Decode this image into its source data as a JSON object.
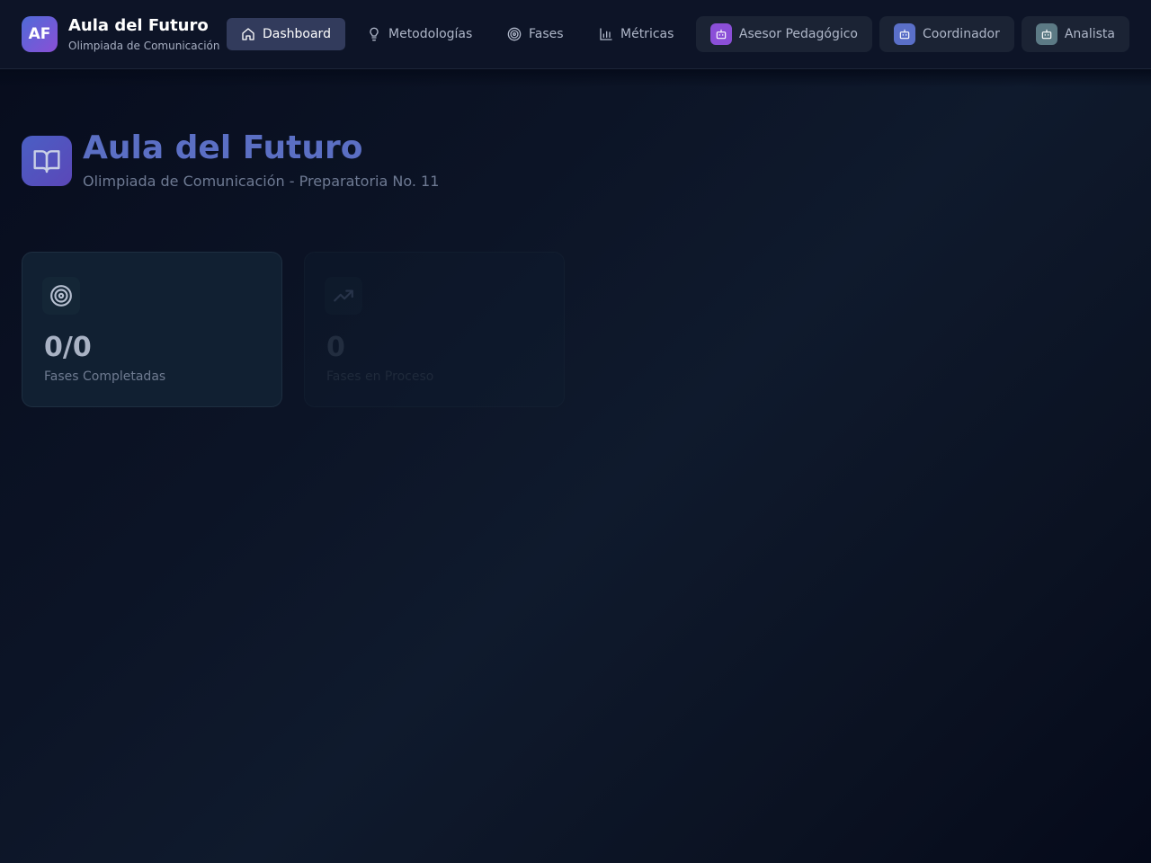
{
  "brand": {
    "logo_text": "AF",
    "title": "Aula del Futuro",
    "subtitle": "Olimpiada de Comunicación"
  },
  "nav": {
    "items": [
      {
        "label": "Dashboard",
        "icon": "home-icon",
        "active": true
      },
      {
        "label": "Metodologías",
        "icon": "lightbulb-icon",
        "active": false
      },
      {
        "label": "Fases",
        "icon": "target-icon",
        "active": false
      },
      {
        "label": "Métricas",
        "icon": "bar-chart-icon",
        "active": false
      }
    ]
  },
  "agents": [
    {
      "label": "Asesor Pedagógico",
      "icon": "bot-icon",
      "color": "#8b4fd8"
    },
    {
      "label": "Coordinador",
      "icon": "bot-icon",
      "color": "#5a6fc8"
    },
    {
      "label": "Analista",
      "icon": "bot-icon",
      "color": "#5c7a85"
    }
  ],
  "hero": {
    "icon": "book-open-icon",
    "title": "Aula del Futuro",
    "subtitle": "Olimpiada de Comunicación - Preparatoria No. 11"
  },
  "stats": [
    {
      "icon": "target-icon",
      "value": "0/0",
      "label": "Fases Completadas"
    },
    {
      "icon": "trending-up-icon",
      "value": "0",
      "label": "Fases en Proceso"
    }
  ],
  "colors": {
    "accent": "#5b6fc4",
    "nav_active_bg": "#323b5c",
    "background": "#0c1426"
  }
}
